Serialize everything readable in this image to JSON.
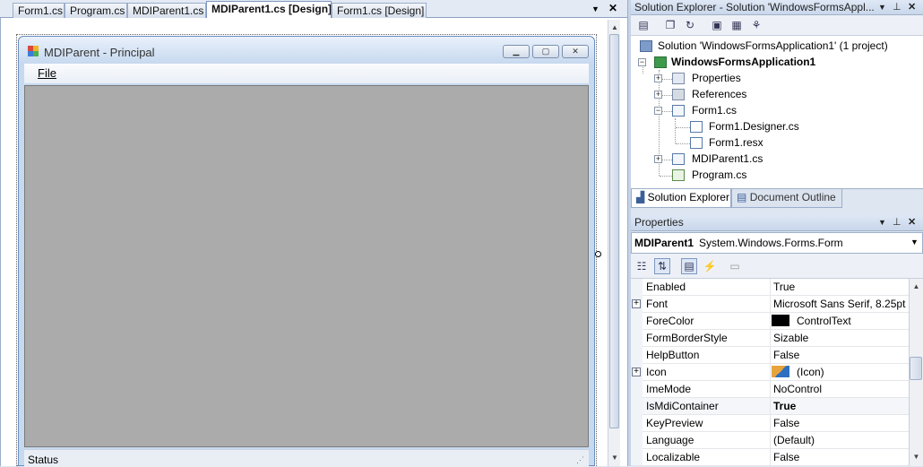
{
  "doc_tabs": [
    "Form1.cs",
    "Program.cs",
    "MDIParent1.cs",
    "MDIParent1.cs [Design]",
    "Form1.cs [Design]"
  ],
  "doc_strip": {
    "dropdown_icon": "chevron-down-icon",
    "close_icon": "close-icon",
    "close_glyph": "✕",
    "dropdown_glyph": "▼"
  },
  "form": {
    "title": "MDIParent - Principal",
    "menu_file": "File",
    "status_text": "Status",
    "caption_buttons": {
      "minimize": "▁",
      "maximize": "▢",
      "close": "✕"
    }
  },
  "solution_explorer": {
    "title": "Solution Explorer - Solution 'WindowsFormsAppl...",
    "tree": {
      "solution": "Solution 'WindowsFormsApplication1' (1 project)",
      "project": "WindowsFormsApplication1",
      "properties": "Properties",
      "references": "References",
      "form1": "Form1.cs",
      "form1_designer": "Form1.Designer.cs",
      "form1_resx": "Form1.resx",
      "mdiparent1": "MDIParent1.cs",
      "program": "Program.cs"
    },
    "tabs": {
      "solution_explorer": "Solution Explorer",
      "document_outline": "Document Outline"
    }
  },
  "properties": {
    "title": "Properties",
    "object_name": "MDIParent1",
    "object_type": "System.Windows.Forms.Form",
    "rows": [
      {
        "name": "Enabled",
        "value": "True"
      },
      {
        "name": "Font",
        "value": "Microsoft Sans Serif, 8.25pt"
      },
      {
        "name": "ForeColor",
        "value": "ControlText"
      },
      {
        "name": "FormBorderStyle",
        "value": "Sizable"
      },
      {
        "name": "HelpButton",
        "value": "False"
      },
      {
        "name": "Icon",
        "value": "(Icon)"
      },
      {
        "name": "ImeMode",
        "value": "NoControl"
      },
      {
        "name": "IsMdiContainer",
        "value": "True"
      },
      {
        "name": "KeyPreview",
        "value": "False"
      },
      {
        "name": "Language",
        "value": "(Default)"
      },
      {
        "name": "Localizable",
        "value": "False"
      }
    ]
  },
  "colors": {
    "mdi_client": "#ababab",
    "accent": "#c9d7eb",
    "forecolor_swatch": "#000000"
  }
}
